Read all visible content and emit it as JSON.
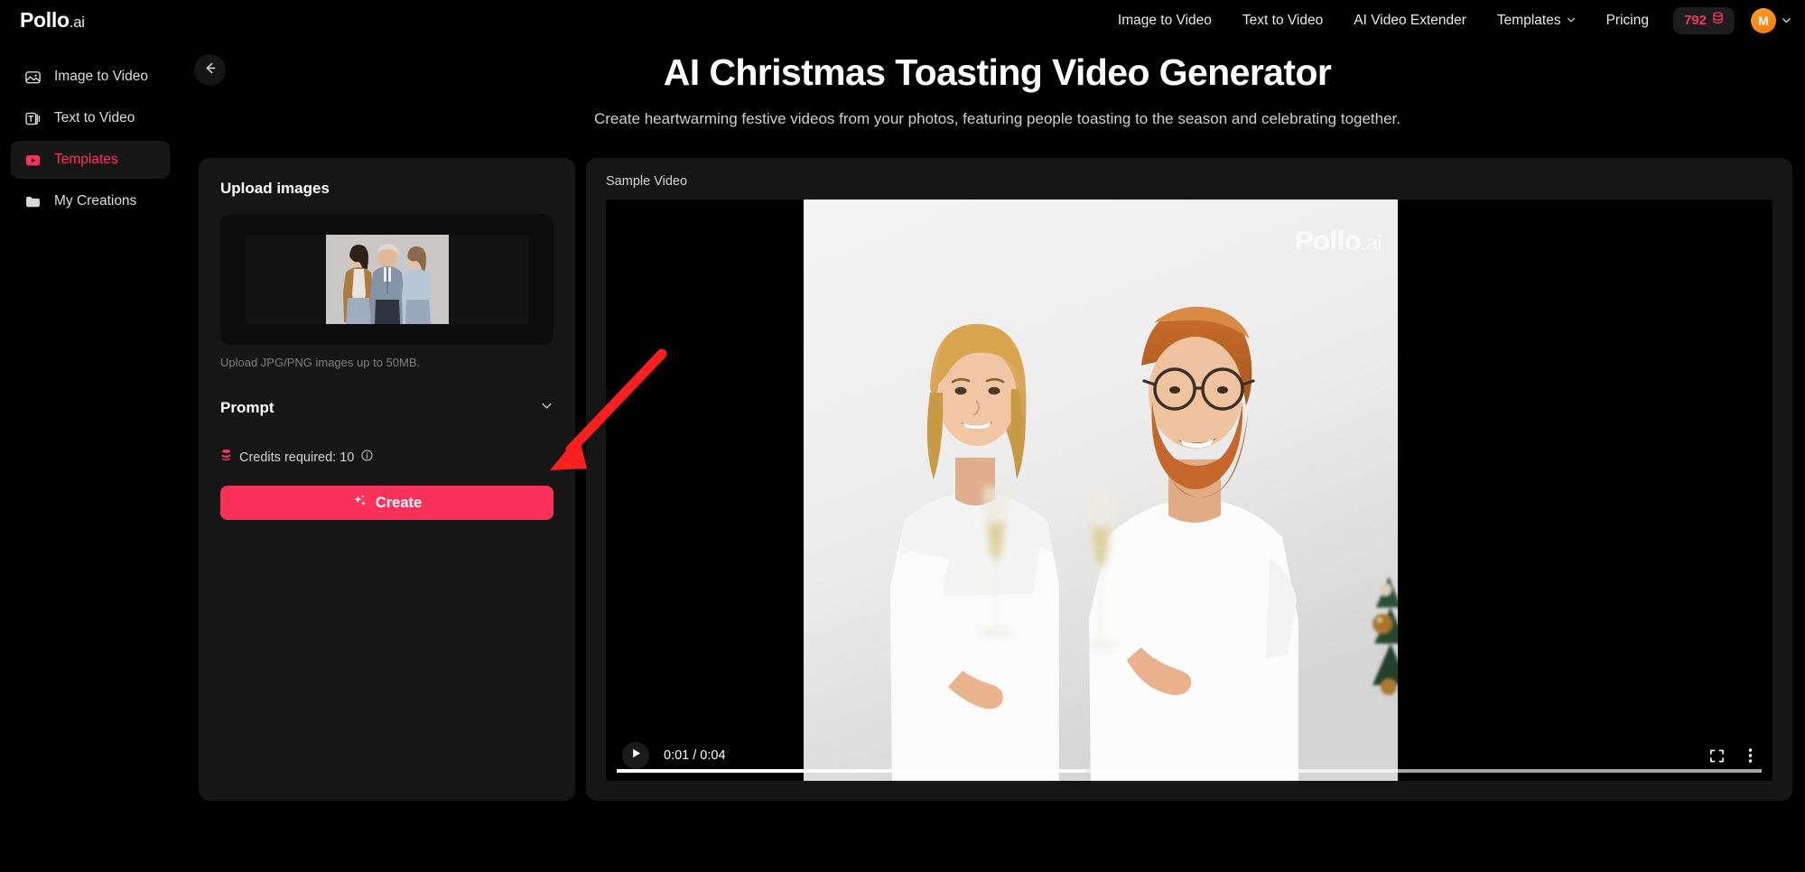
{
  "brand": {
    "name": "Pollo",
    "suffix": ".ai"
  },
  "topnav": {
    "links": [
      {
        "label": "Image to Video",
        "icon": "none"
      },
      {
        "label": "Text to Video",
        "icon": "none"
      },
      {
        "label": "AI Video Extender",
        "icon": "none"
      },
      {
        "label": "Templates",
        "icon": "chevron-down-icon"
      },
      {
        "label": "Pricing",
        "icon": "none"
      }
    ],
    "credits": {
      "value": "792",
      "icon": "coin-stack-icon"
    },
    "avatar": {
      "initial": "M",
      "icon": "chevron-down-icon"
    }
  },
  "sidebar": {
    "items": [
      {
        "label": "Image to Video",
        "icon": "image-icon",
        "active": false
      },
      {
        "label": "Text to Video",
        "icon": "text-icon",
        "active": false
      },
      {
        "label": "Templates",
        "icon": "video-play-icon",
        "active": true
      },
      {
        "label": "My Creations",
        "icon": "folder-icon",
        "active": false
      }
    ]
  },
  "back_button": {
    "icon": "arrow-left-icon",
    "label": "Back"
  },
  "header": {
    "title": "AI Christmas Toasting Video Generator",
    "subtitle": "Create heartwarming festive videos from your photos, featuring people toasting to the season and celebrating together."
  },
  "upload_panel": {
    "title": "Upload images",
    "hint": "Upload JPG/PNG images up to 50MB.",
    "thumbnail_alt": "Three people standing together against a gray backdrop"
  },
  "prompt_section": {
    "label": "Prompt",
    "icon": "chevron-down-icon",
    "expanded": false
  },
  "credits_required": {
    "label": "Credits required: 10",
    "icon": "coin-stack-icon",
    "info_icon": "info-icon"
  },
  "create_button": {
    "label": "Create",
    "icon": "sparkle-icon"
  },
  "sample_video": {
    "label": "Sample Video",
    "current_time": "0:01",
    "duration": "0:04",
    "time_display": "0:01 / 0:04",
    "played_percent": 41,
    "buffered_percent": 100,
    "watermark": {
      "name": "Pollo",
      "suffix": ".ai"
    },
    "play_icon": "play-icon",
    "fullscreen_icon": "fullscreen-icon",
    "more_icon": "more-vertical-icon",
    "scene_alt": "A woman and a bearded man in white t-shirts toasting champagne glasses with a Christmas tree at right"
  },
  "annotation": {
    "type": "arrow",
    "color": "#fb2020",
    "points_to": "create-button"
  },
  "colors": {
    "accent": "#fa3259",
    "credit_text": "#f8335e",
    "panel_bg": "#161616",
    "page_bg": "#000000",
    "avatar_bg": "#f97a08",
    "annotation_red": "#fb2020"
  }
}
